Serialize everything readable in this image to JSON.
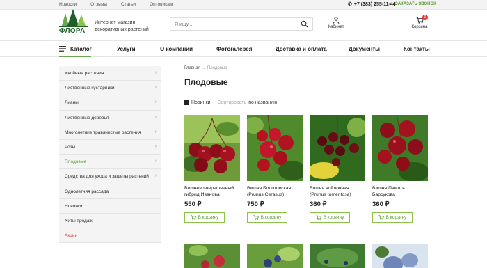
{
  "topbar": {
    "links": [
      "Новости",
      "Отзывы",
      "Статьи",
      "Оптовикам"
    ],
    "phone": "+7 (383) 255-11-44",
    "callback": "ЗАКАЗАТЬ ЗВОНОК"
  },
  "header": {
    "logo_text": "ФЛОРА",
    "tagline_1": "Интернет магазин",
    "tagline_2": "декоративных растений",
    "search_placeholder": "Я ищу...",
    "account_label": "Кабинет",
    "cart_label": "Корзина",
    "cart_count": "0"
  },
  "nav": {
    "items": [
      "Каталог",
      "Услуги",
      "О компании",
      "Фотогалерея",
      "Доставка и оплата",
      "Документы",
      "Контакты"
    ]
  },
  "sidebar": {
    "items": [
      {
        "label": "Хвойные растения",
        "arrow": "›"
      },
      {
        "label": "Лиственные кустарники",
        "arrow": "›"
      },
      {
        "label": "Лианы",
        "arrow": "›"
      },
      {
        "label": "Лиственные деревья",
        "arrow": "›"
      },
      {
        "label": "Многолетние травянистые растения",
        "arrow": "›"
      },
      {
        "label": "Розы",
        "arrow": "›"
      },
      {
        "label": "Плодовые",
        "arrow": "›"
      },
      {
        "label": "Средства для ухода и защиты растений",
        "arrow": "›"
      },
      {
        "label": "Однолетняя рассада",
        "arrow": ""
      },
      {
        "label": "Новинки",
        "arrow": ""
      },
      {
        "label": "Хиты продаж",
        "arrow": ""
      },
      {
        "label": "Акции",
        "arrow": ""
      }
    ]
  },
  "main": {
    "breadcrumb_home": "Главная",
    "breadcrumb_sep": "→",
    "breadcrumb_current": "Плодовые",
    "title": "Плодовые",
    "sort_new": "Новинки",
    "sort_label": "Сортировать",
    "sort_value": "по названию",
    "buy_label": "В корзину",
    "products": [
      {
        "name_1": "Вишнево-черешневый",
        "name_2": "гибрид Иванова",
        "price": "550 ₽"
      },
      {
        "name_1": "Вишня Болотовская",
        "name_2": "(Prunus Cerasus)",
        "price": "750 ₽"
      },
      {
        "name_1": "Вишня войлочная",
        "name_2": "(Prunus tomentosa)",
        "price": "360 ₽"
      },
      {
        "name_1": "Вишня Память",
        "name_2": "Барсукова",
        "price": "360 ₽"
      }
    ]
  },
  "colors": {
    "accent": "#5a9e2f",
    "brand_dark": "#1f5f2a",
    "sale": "#e53935"
  }
}
